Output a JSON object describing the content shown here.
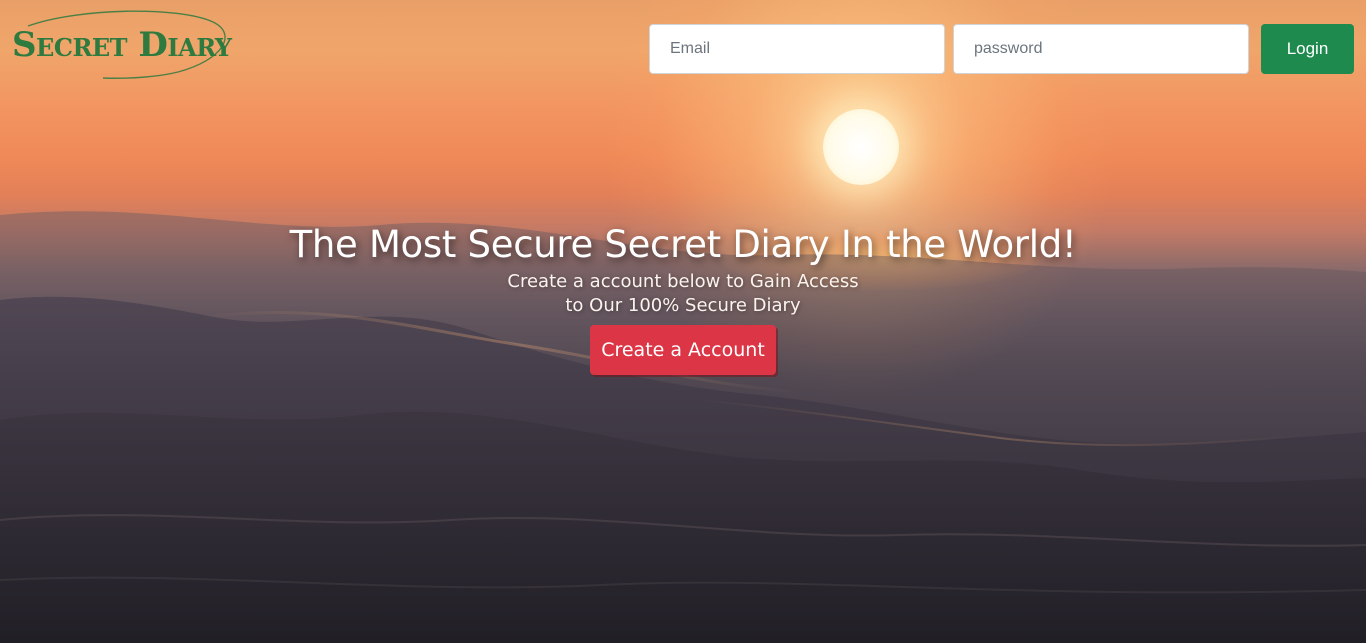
{
  "brand": {
    "logo_text": "Secret Diary",
    "color": "#2f7a3f"
  },
  "login": {
    "email_placeholder": "Email",
    "email_value": "",
    "password_placeholder": "password",
    "password_value": "",
    "button_label": "Login",
    "button_color": "#1e8a4e"
  },
  "hero": {
    "title": "The Most Secure Secret Diary In the World!",
    "subtitle_line1": "Create a account below to Gain Access",
    "subtitle_line2": "to Our 100% Secure Diary",
    "cta_label": "Create a Account",
    "cta_color": "#dc3545"
  },
  "background": {
    "description_icon": "sunset-ocean-waves-image"
  }
}
